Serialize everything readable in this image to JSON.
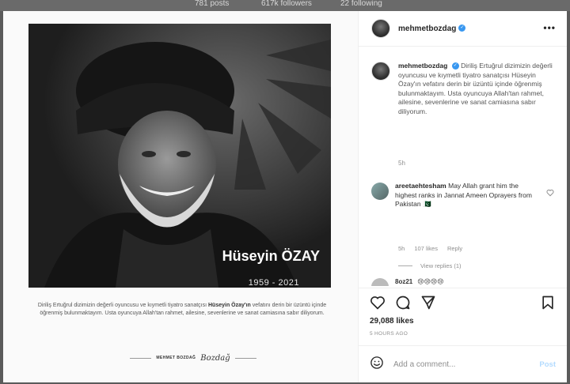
{
  "background": {
    "stats": [
      "781 posts",
      "617k followers",
      "22 following"
    ]
  },
  "post_image": {
    "name_overlay": "Hüseyin ÖZAY",
    "years_overlay": "1959 - 2021",
    "tribute_part1": "Diriliş Ertuğrul dizimizin değerli oyuncusu ve kıymetli tiyatro sanatçısı",
    "tribute_bold": "Hüseyin Özay'ın",
    "tribute_part2": "vefatını derin bir üzüntü içinde öğrenmiş bulunmaktayım. Usta oyuncuya Allah'tan rahmet, ailesine, sevenlerine ve sanat camiasına sabır diliyorum.",
    "signature_name": "MEHMET BOZDAĞ",
    "signature_scribble": "Bozdağ"
  },
  "header": {
    "username": "mehmetbozdag",
    "verified_mark": "✓",
    "more_label": "•••"
  },
  "caption": {
    "username": "mehmetbozdag",
    "text": "Diriliş Ertuğrul dizimizin değerli oyuncusu ve kıymetli tiyatro sanatçısı Hüseyin Özay'ın vefatını derin bir üzüntü içinde öğrenmiş bulunmaktayım. Usta oyuncuya Allah'tan rahmet, ailesine, sevenlerine ve sanat camiasına sabır diliyorum.",
    "time": "5h"
  },
  "comment": {
    "username": "areetaehtesham",
    "text": "May Allah grant him the highest ranks in Jannat Ameen Oprayers from Pakistan 🇵🇰",
    "time": "5h",
    "likes": "107 likes",
    "reply_label": "Reply",
    "view_replies": "View replies (1)"
  },
  "next_comment": {
    "username": "8oz21",
    "text": "😢😢😢😢"
  },
  "actions": {
    "likes_count": "29,088 likes",
    "post_time": "5 HOURS AGO",
    "comment_placeholder": "Add a comment...",
    "post_button": "Post"
  }
}
